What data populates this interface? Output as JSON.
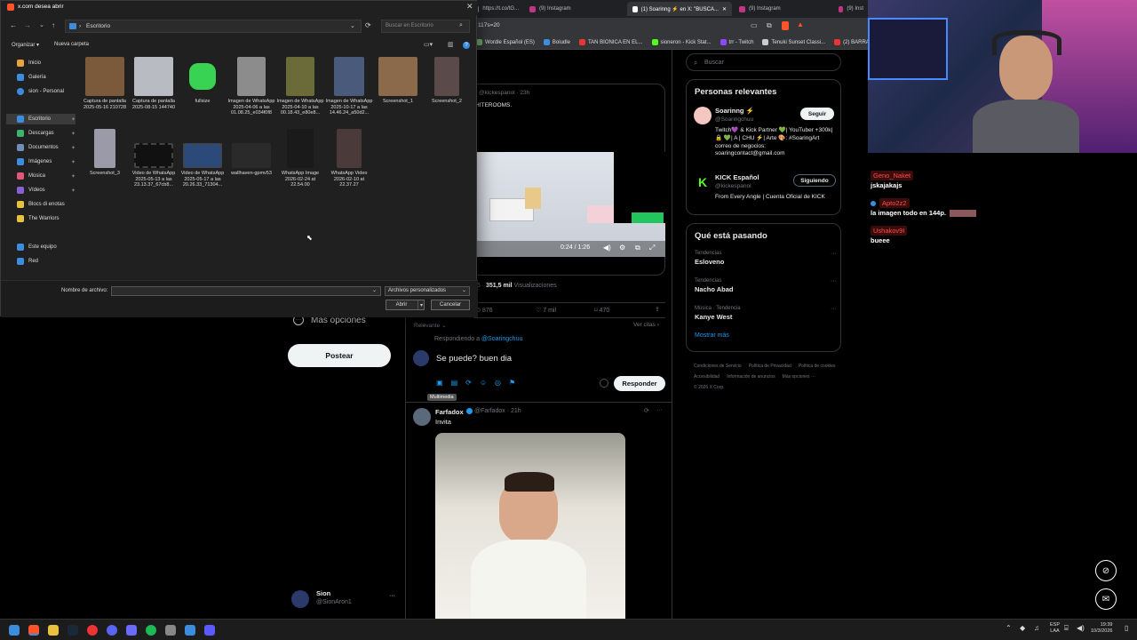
{
  "browser": {
    "tabs": [
      {
        "label": "https://t.co/tG...",
        "active": false
      },
      {
        "label": "(9) Instagram",
        "active": false
      },
      {
        "label": "(1) Soarinng ⚡ en X: \"BUSCA...",
        "active": true
      },
      {
        "label": "(9) Instagram",
        "active": false
      },
      {
        "label": "(9) Inst",
        "active": false
      }
    ],
    "url": "117s=20",
    "bookmarks": [
      "Wordle Español (ES)",
      "Boludle",
      "TAN BIONICA EN EL...",
      "sioneron - Kick Stat...",
      "trr - Twitch",
      "Tenuki Sunset Classi...",
      "(2) BARRA"
    ]
  },
  "x_left": {
    "more_options": "Más opciones",
    "post_button": "Postear",
    "account_name": "Sion",
    "account_handle": "@SionAron1",
    "account_more": "···"
  },
  "x_center": {
    "tweet_author_handle": "@kickespanol · 23h",
    "tweet_text_fragment": "HITEROOMS.",
    "video_time": "0:24 / 1:26",
    "views_prefix": "26 ·",
    "views_value": "351,5 mil",
    "views_label": "Visualizaciones",
    "stat_retweets": "876",
    "stat_likes": "7 mil",
    "stat_bookmarks": "470",
    "relevance": "Relevante ⌄",
    "ver_citas": "Ver citas ›",
    "replying_to_prefix": "Respondiendo a",
    "replying_to_handle": "@Soaringchuu",
    "reply_draft": "Se puede? buen dia",
    "reply_button": "Responder",
    "multimedia_tooltip": "Multimedia",
    "reply_tweet_author": "Farfadox",
    "reply_tweet_handle": "@Farfadox · 21h",
    "reply_tweet_text": "Invita"
  },
  "x_right": {
    "search_placeholder": "Buscar",
    "relevant_title": "Personas relevantes",
    "person1_name": "Soarinng ⚡",
    "person1_handle": "@Soaringchuu",
    "person1_bio": "Twitch💜 & Kick Partner 💚| YouTuber +300k| 🔒 💚| A | CHU ⚡| Arte 🎨: #SoaringArt correo de negocios: soaringcontact@gmail.com",
    "person1_button": "Seguir",
    "person2_name": "KICK Español",
    "person2_handle": "@kickespanol",
    "person2_bio": "From Every Angle | Cuenta Oficial de KICK",
    "person2_button": "Siguiendo",
    "trends_title": "Qué está pasando",
    "trends": [
      {
        "category": "Tendencias",
        "name": "Esloveno"
      },
      {
        "category": "Tendencias",
        "name": "Nacho Abad"
      },
      {
        "category": "Música · Tendencia",
        "name": "Kanye West"
      }
    ],
    "show_more": "Mostrar más",
    "footer_links": [
      "Condiciones de Servicio",
      "Política de Privacidad",
      "Política de cookies",
      "Accesibilidad",
      "Información de anuncios",
      "Más opciones ···",
      "© 2026 X Corp."
    ]
  },
  "dialog": {
    "title": "x.com desea abrir",
    "path": "Escritorio",
    "search_placeholder": "Buscar en Escritorio",
    "organize": "Organizar ▾",
    "new_folder": "Nueva carpeta",
    "nav": [
      {
        "label": "Inicio",
        "color": "#e8a33d"
      },
      {
        "label": "Galería",
        "color": "#3c8dde"
      },
      {
        "label": "sion - Personal",
        "color": "#3c8dde"
      },
      {
        "label": "Escritorio",
        "color": "#3c8dde"
      },
      {
        "label": "Descargas",
        "color": "#3cb371"
      },
      {
        "label": "Documentos",
        "color": "#6f8fb8"
      },
      {
        "label": "Imágenes",
        "color": "#3c8dde"
      },
      {
        "label": "Música",
        "color": "#e0577a"
      },
      {
        "label": "Vídeos",
        "color": "#8a5ed6"
      },
      {
        "label": "Blocs di enotas",
        "color": "#e8c23d"
      },
      {
        "label": "The Warriors",
        "color": "#e8c23d"
      },
      {
        "label": "Este equipo",
        "color": "#3c8dde"
      },
      {
        "label": "Red",
        "color": "#3c8dde"
      }
    ],
    "files": [
      {
        "label": "Captura de pantalla 2025-05-16 210728",
        "color": "#7a5a3a"
      },
      {
        "label": "Captura de pantalla 2025-08-15 144740",
        "color": "#b8bcc2"
      },
      {
        "label": "fullsize",
        "color": "#39d353"
      },
      {
        "label": "Imagen de WhatsApp 2025-04-06 a las 01.08.25_e034f0f8",
        "color": "#8c8c8c"
      },
      {
        "label": "Imagen de WhatsApp 2025-04-10 a las 00.18.43_e80e8...",
        "color": "#6b6b3a"
      },
      {
        "label": "Imagen de WhatsApp 2025-10-17 a las 14.46.24_a50d2...",
        "color": "#4a5a7a"
      },
      {
        "label": "Screenshot_1",
        "color": "#8a6a4a"
      },
      {
        "label": "Screenshot_2",
        "color": "#5a4a4a"
      },
      {
        "label": "Screenshot_3",
        "color": "#9a9aa8"
      },
      {
        "label": "Video de WhatsApp 2025-05-13 a las 23.13.37_67cb8...",
        "color": "#111111"
      },
      {
        "label": "Video de WhatsApp 2025-05-17 a las 20.26.33_71304...",
        "color": "#2b4a7a"
      },
      {
        "label": "wallhaven-gpmv53",
        "color": "#2a2a2a"
      },
      {
        "label": "WhatsApp Image 2026-02-24 at 22.54.00",
        "color": "#1a1a1a"
      },
      {
        "label": "WhatsApp Video 2026-02-10 at 22.37.27",
        "color": "#4a3a3a"
      }
    ],
    "filename_label": "Nombre de archivo:",
    "filename_value": "",
    "filetype": "Archivos personalizados",
    "open_button": "Abrir",
    "cancel_button": "Cancelar"
  },
  "stream_chat": {
    "messages": [
      {
        "user": "Geno_Naket",
        "text": "jskajakajs"
      },
      {
        "user": "Apto2z2",
        "text": "la imagen todo en 144p."
      },
      {
        "user": "Ushakov9I",
        "text": "bueee"
      }
    ]
  },
  "taskbar": {
    "lang_top": "ESP",
    "lang_bottom": "LAA",
    "time": "19:39",
    "date": "10/3/2026"
  }
}
